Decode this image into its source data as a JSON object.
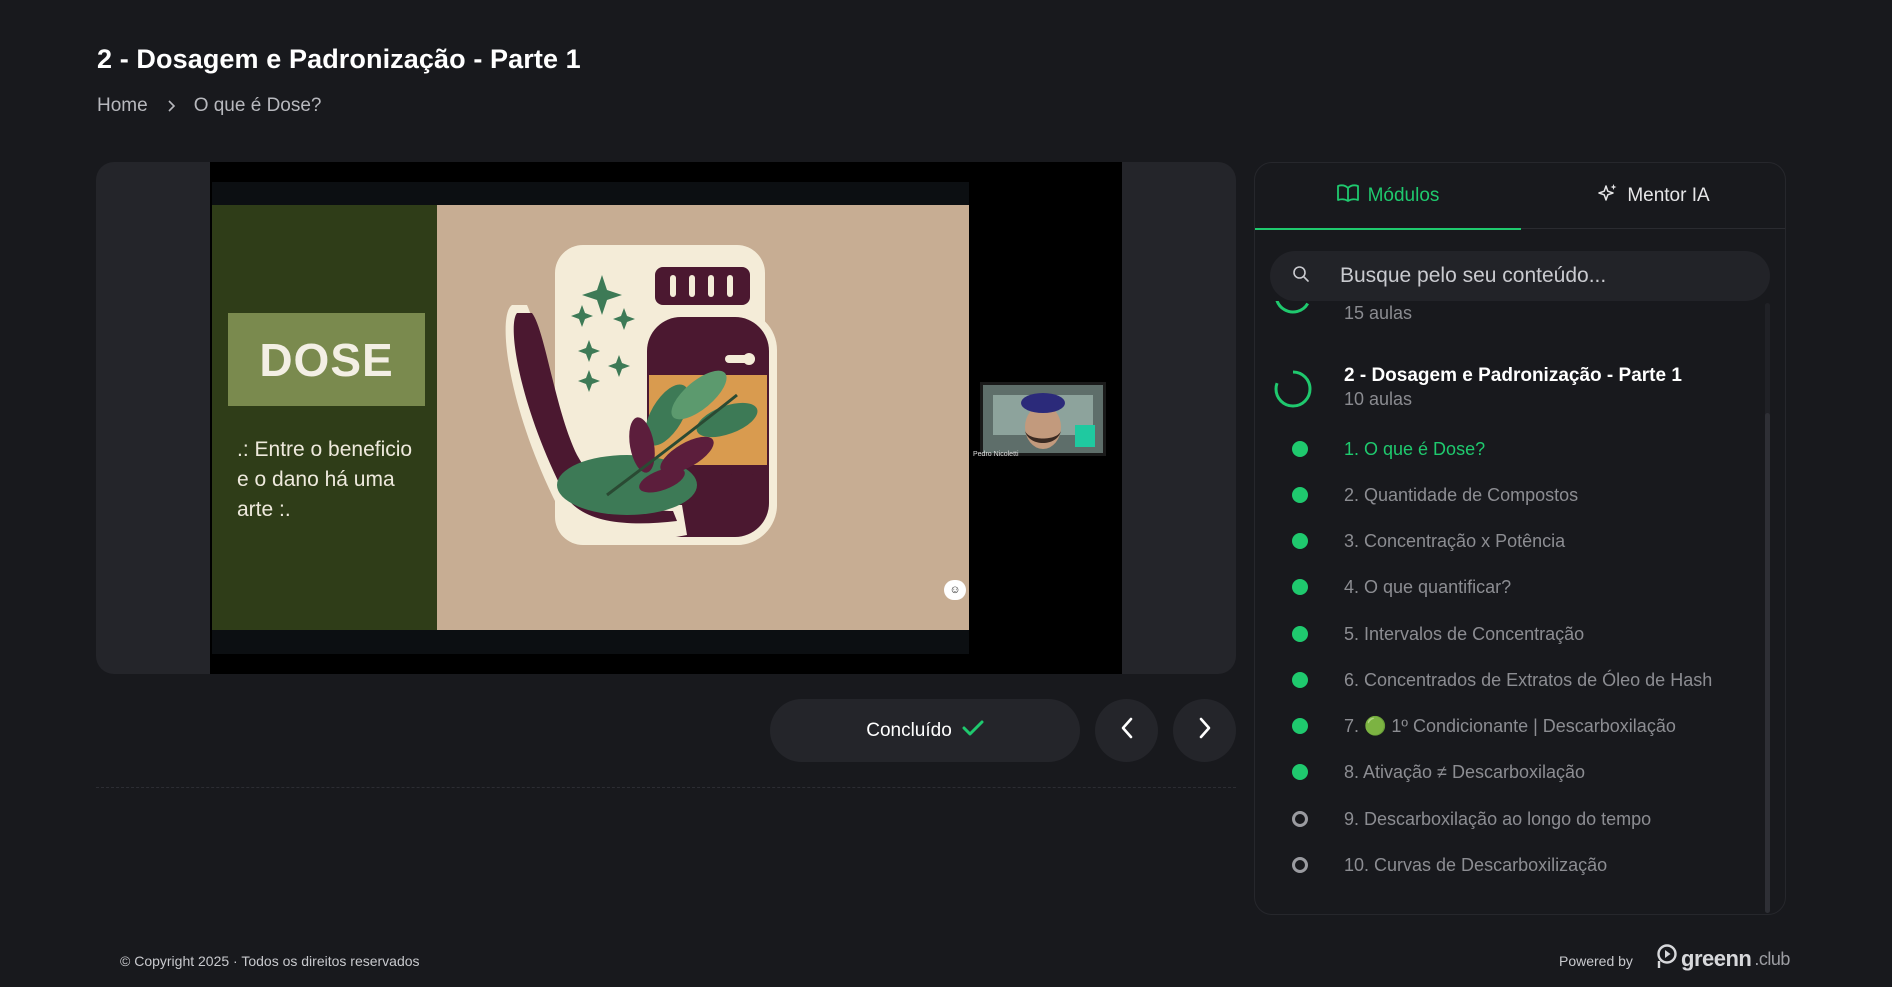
{
  "page": {
    "title": "2 - Dosagem e Padronização - Parte 1",
    "breadcrumb": [
      "Home",
      "O que é Dose?"
    ]
  },
  "video": {
    "slide_heading": "DOSE",
    "slide_text": ".: Entre o beneficio e o dano há uma arte :.",
    "presenter_name": "Pedro Nicoletti",
    "slide_badge_icon": "smile-icon"
  },
  "controls": {
    "done_label": "Concluído",
    "done_icon": "check-icon",
    "prev_icon": "chevron-left-icon",
    "next_icon": "chevron-right-icon"
  },
  "sidebar": {
    "tabs": [
      {
        "label": "Módulos",
        "icon": "book-icon",
        "active": true
      },
      {
        "label": "Mentor IA",
        "icon": "sparkles-icon",
        "active": false
      }
    ],
    "search_placeholder": "Busque pelo seu conteúdo...",
    "modules": [
      {
        "title": "",
        "count": "15 aulas",
        "progress": 0.6
      },
      {
        "title": "2 - Dosagem e Padronização - Parte 1",
        "count": "10 aulas",
        "progress": 0.8
      }
    ],
    "lessons": [
      {
        "label": "1. O que é Dose?",
        "status": "done",
        "current": true
      },
      {
        "label": "2. Quantidade de Compostos",
        "status": "done",
        "current": false
      },
      {
        "label": "3. Concentração x Potência",
        "status": "done",
        "current": false
      },
      {
        "label": "4. O que quantificar?",
        "status": "done",
        "current": false
      },
      {
        "label": "5. Intervalos de Concentração",
        "status": "done",
        "current": false
      },
      {
        "label": "6. Concentrados de Extratos de Óleo de Hash",
        "status": "done",
        "current": false
      },
      {
        "label": "7. 🟢 1º Condicionante | Descarboxilação",
        "status": "done",
        "current": false
      },
      {
        "label": "8. Ativação ≠ Descarboxilação",
        "status": "done",
        "current": false
      },
      {
        "label": "9. Descarboxilação ao longo do tempo",
        "status": "todo",
        "current": false
      },
      {
        "label": "10. Curvas de Descarboxilização",
        "status": "todo",
        "current": false
      }
    ]
  },
  "footer": {
    "copyright": "© Copyright 2025 · Todos os direitos reservados",
    "powered_by": "Powered by",
    "logo_main": "greenn",
    "logo_suffix": ".club"
  },
  "colors": {
    "accent": "#1fc96e",
    "background": "#18191d",
    "card": "#24252a"
  }
}
